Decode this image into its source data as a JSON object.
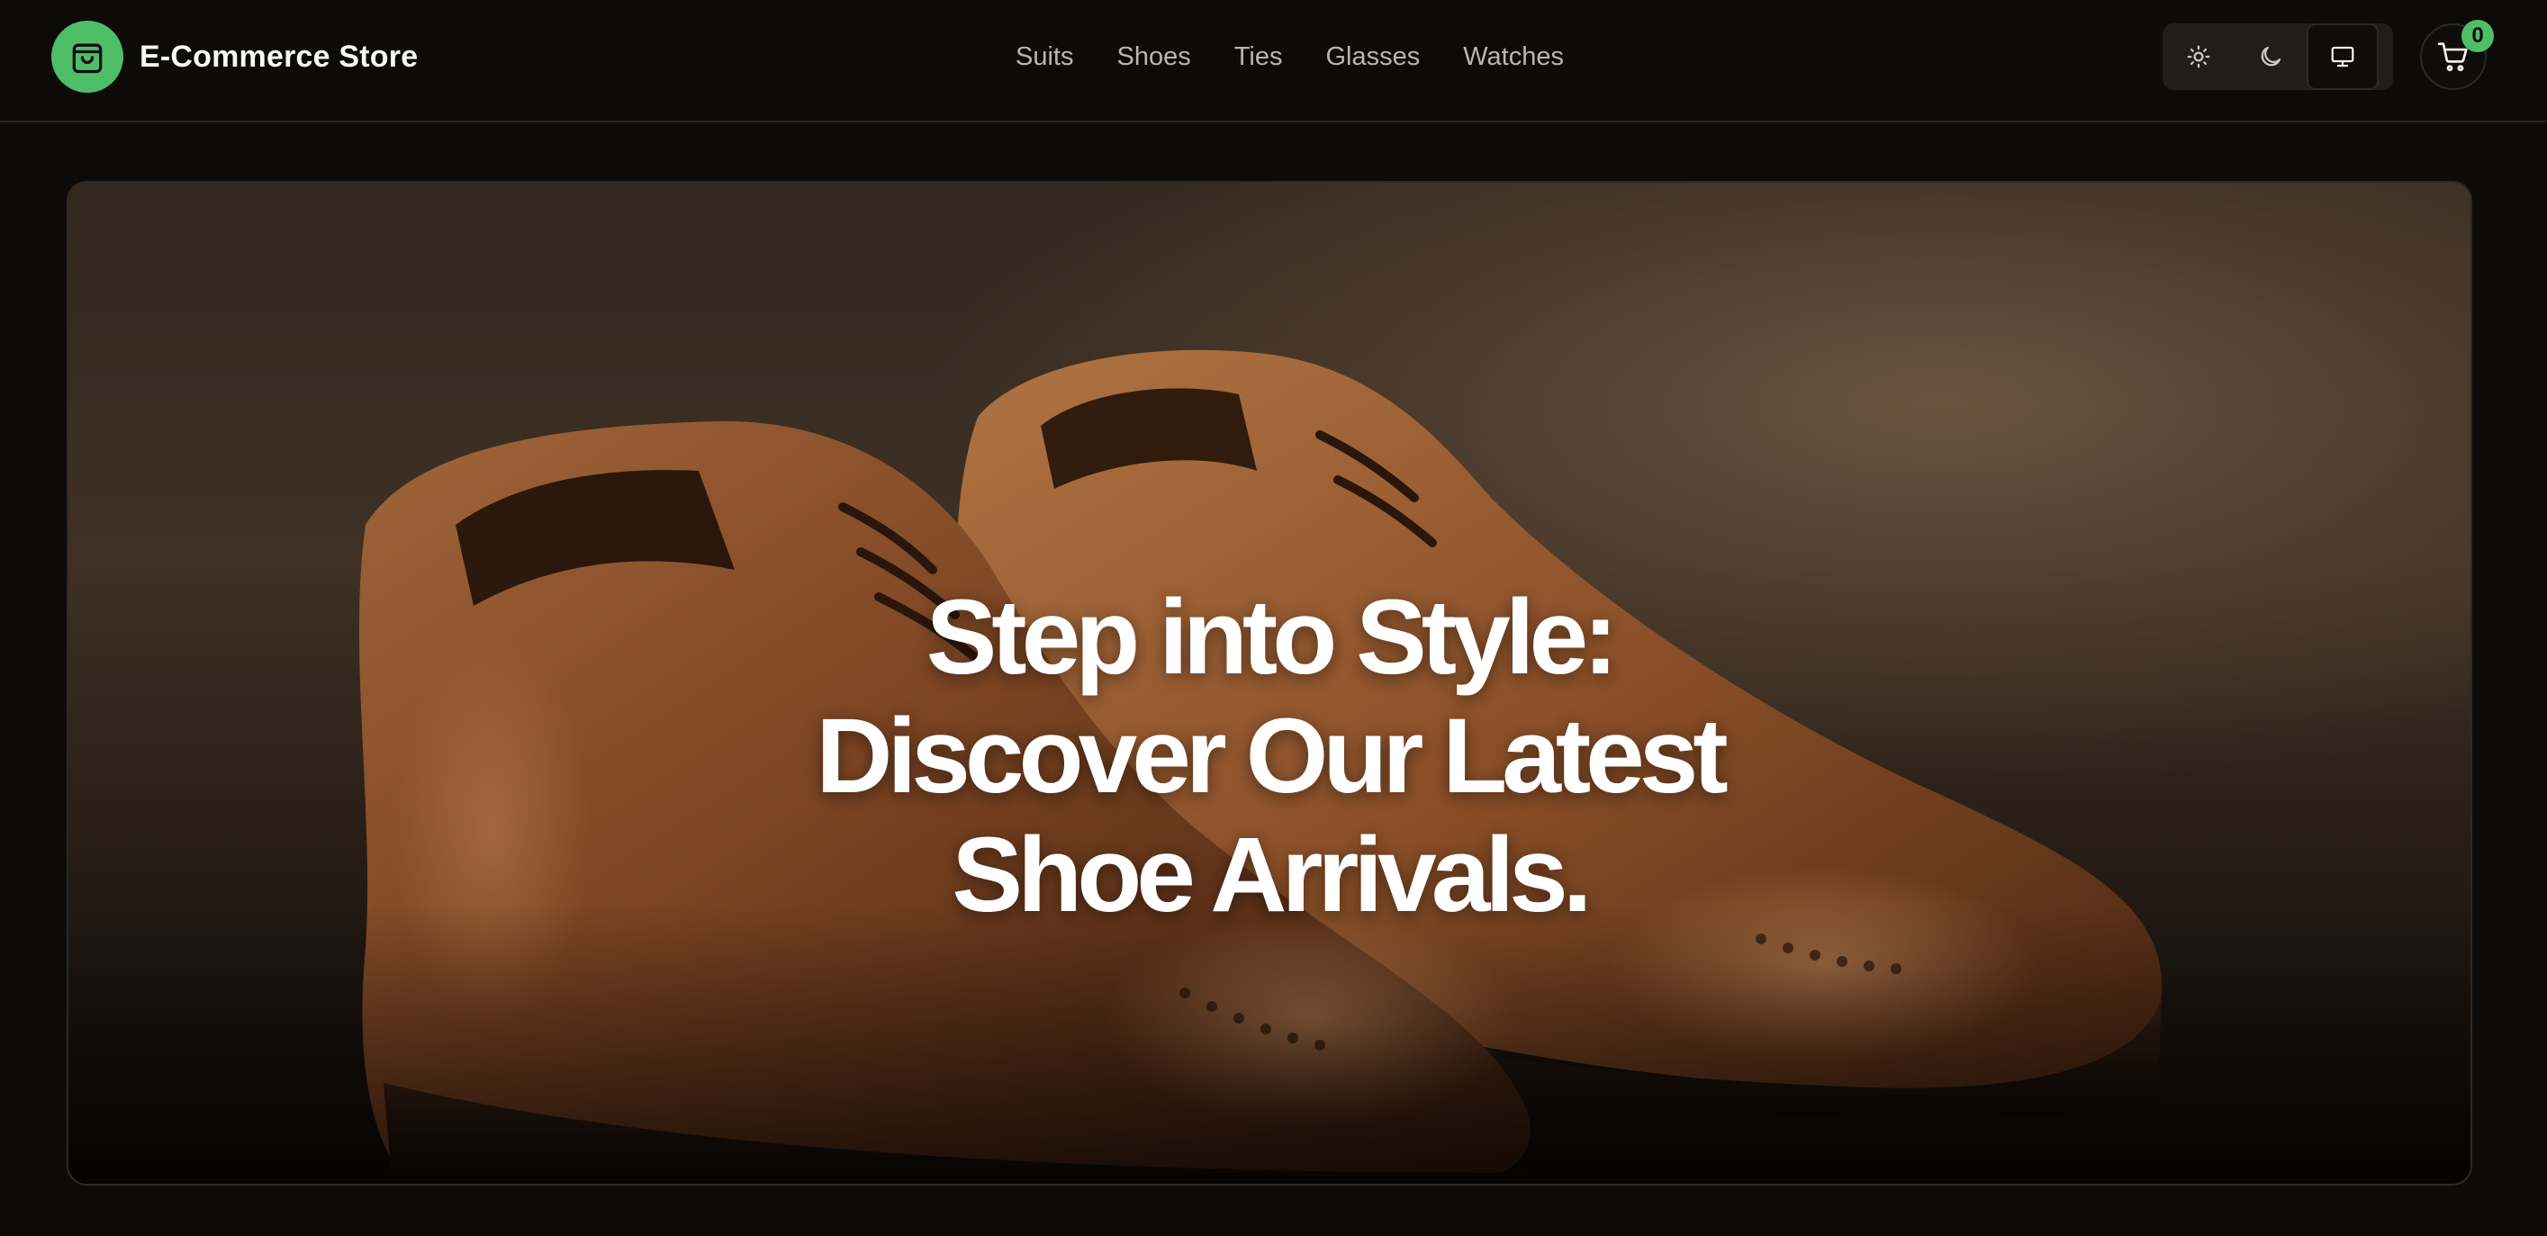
{
  "brand": {
    "name": "E-Commerce Store",
    "logo_icon": "shopping-bag-icon",
    "accent_color": "#4fbe68"
  },
  "nav": {
    "links": [
      "Suits",
      "Shoes",
      "Ties",
      "Glasses",
      "Watches"
    ]
  },
  "theme_toggle": {
    "options": [
      {
        "icon": "sun-icon",
        "active": false
      },
      {
        "icon": "moon-icon",
        "active": false
      },
      {
        "icon": "monitor-icon",
        "active": true
      }
    ]
  },
  "cart": {
    "icon": "cart-icon",
    "count": "0"
  },
  "hero": {
    "title_lines": [
      "Step into Style:",
      "Discover Our Latest",
      "Shoe Arrivals."
    ],
    "image": "brown-leather-brogue-shoes"
  }
}
